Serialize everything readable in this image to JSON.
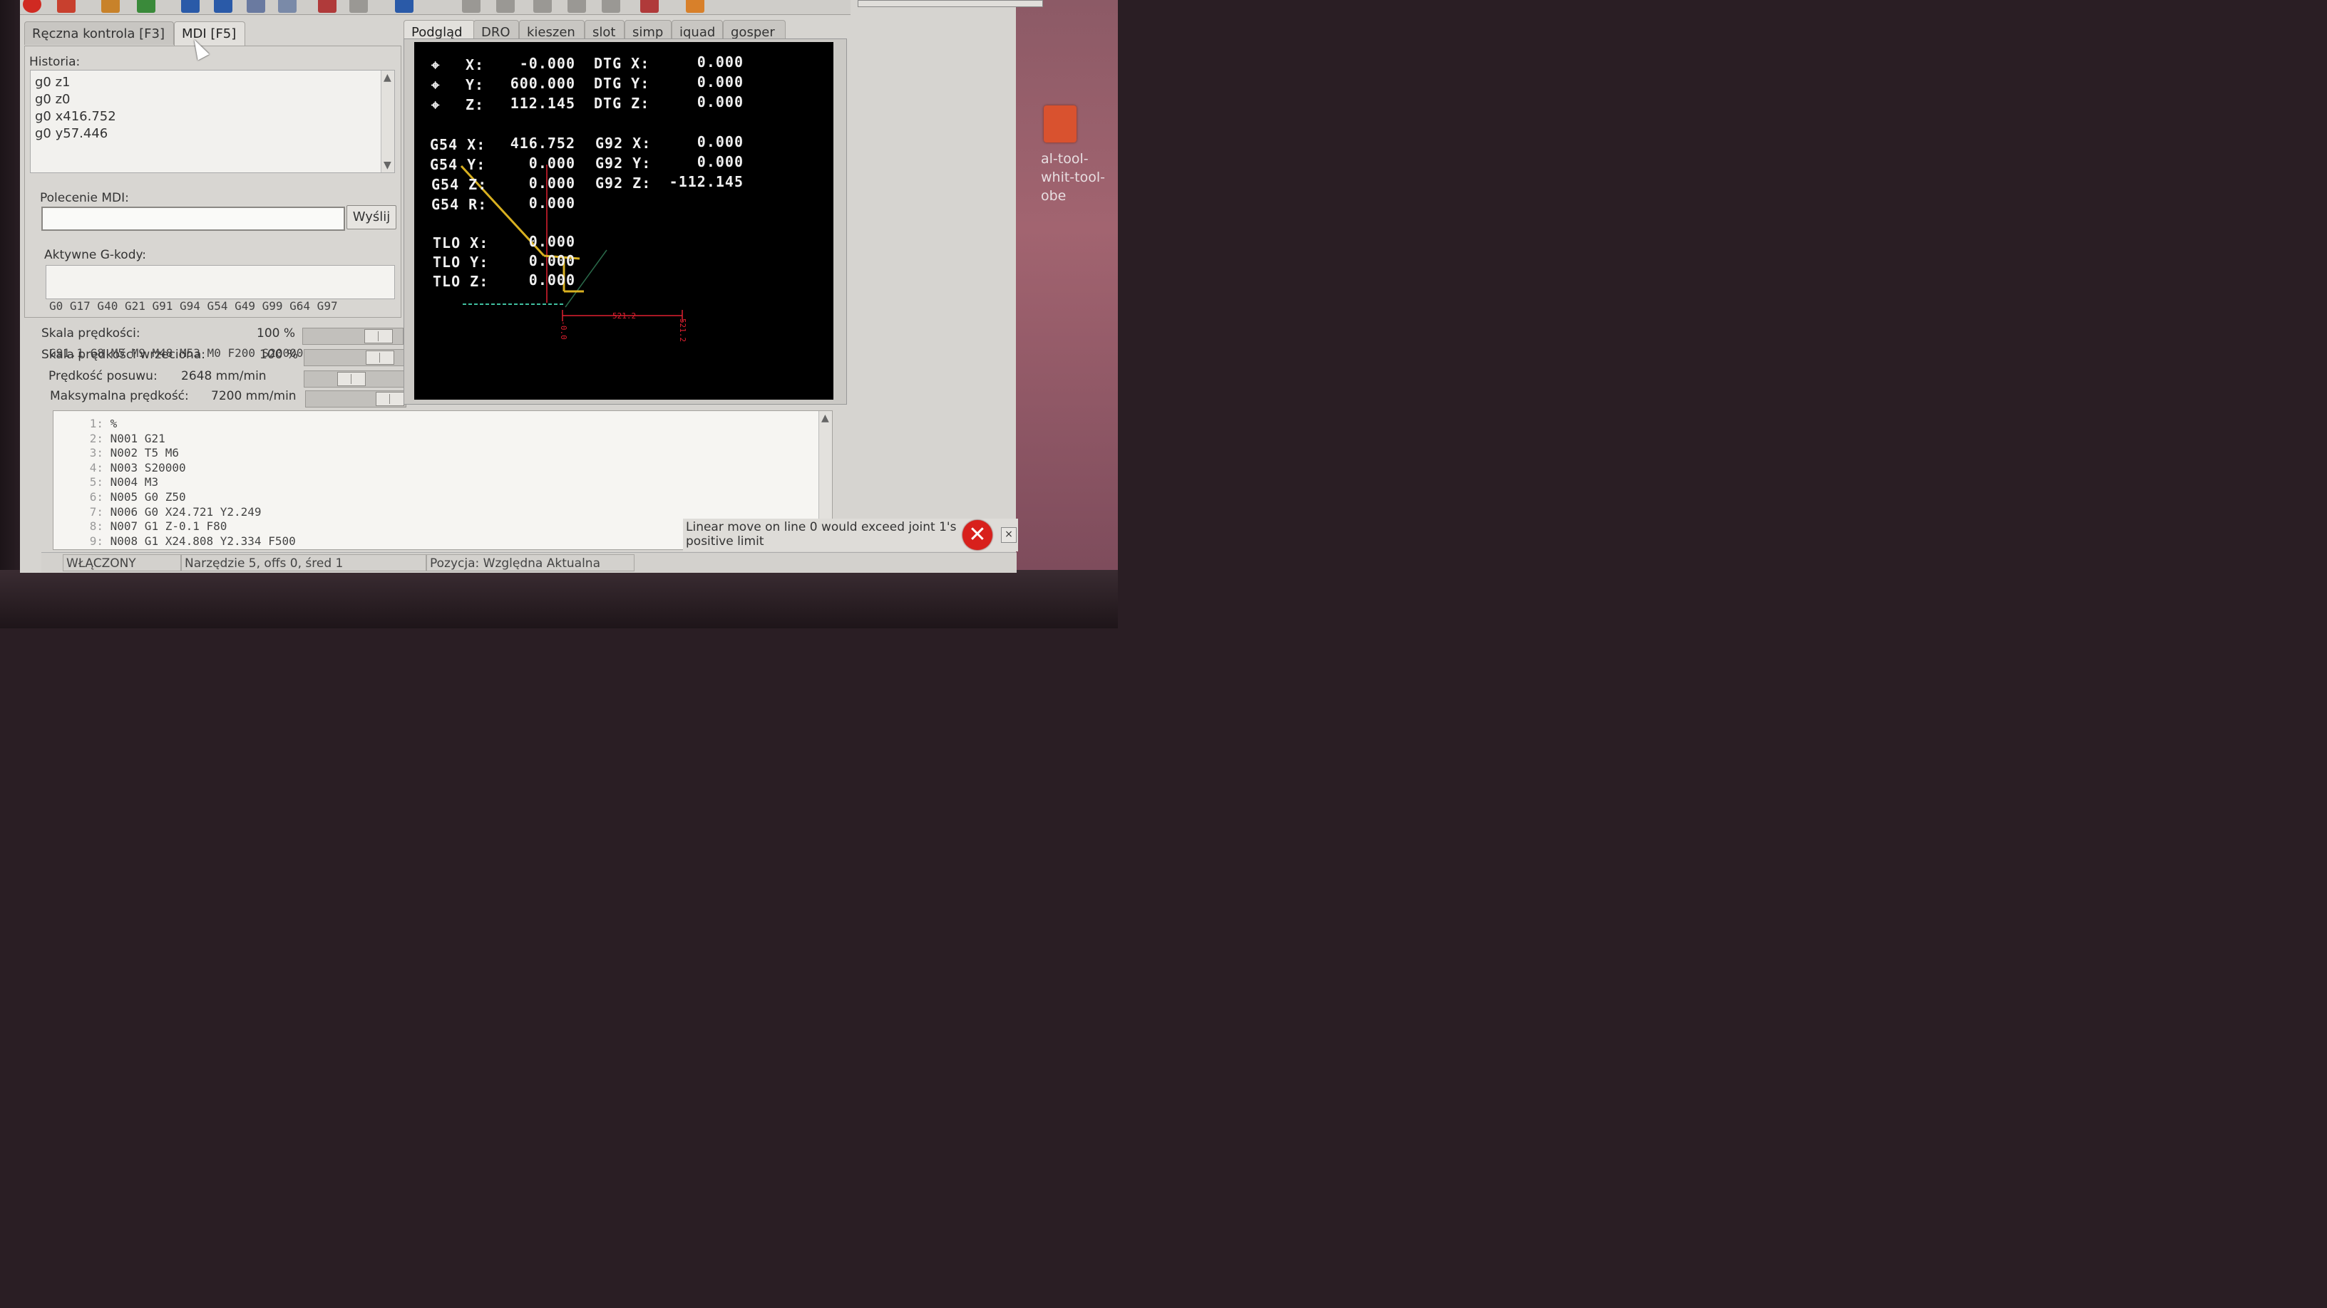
{
  "window": {
    "tabs_left": [
      {
        "label": "Ręczna kontrola [F3]",
        "active": false
      },
      {
        "label": "MDI [F5]",
        "active": true
      }
    ],
    "tabs_right": [
      {
        "label": "Podgląd",
        "active": true
      },
      {
        "label": "DRO",
        "active": false
      },
      {
        "label": "kieszen",
        "active": false
      },
      {
        "label": "slot",
        "active": false
      },
      {
        "label": "simp",
        "active": false
      },
      {
        "label": "iquad",
        "active": false
      },
      {
        "label": "gosper",
        "active": false
      }
    ]
  },
  "mdi": {
    "history_label": "Historia:",
    "history": [
      "g0 z1",
      "g0 z0",
      "g0 x416.752",
      "g0 y57.446"
    ],
    "command_label": "Polecenie MDI:",
    "command_value": "",
    "send_label": "Wyślij",
    "active_gcodes_label": "Aktywne G-kody:",
    "active_gcodes_line1": "G0 G17 G40 G21 G91 G94 G54 G49 G99 G64 G97",
    "active_gcodes_line2": "G91.1 G8 M5 M9 M48 M53 M0 F200 S20000"
  },
  "sliders": [
    {
      "name": "Skala prędkości:",
      "value": "100 %",
      "level": 1.0
    },
    {
      "name": "Skala prędkości wrzeciona:",
      "value": "100 %",
      "level": 1.0
    },
    {
      "name": "Prędkość posuwu:",
      "value": "2648 mm/min",
      "level": 0.37
    },
    {
      "name": "Maksymalna prędkość:",
      "value": "7200 mm/min",
      "level": 1.0
    }
  ],
  "dro": {
    "x_label": "X:",
    "x_value": "-0.000",
    "y_label": "Y:",
    "y_value": "600.000",
    "z_label": "Z:",
    "z_value": "112.145",
    "dtg_x_label": "DTG X:",
    "dtg_x": "0.000",
    "dtg_y_label": "DTG Y:",
    "dtg_y": "0.000",
    "dtg_z_label": "DTG Z:",
    "dtg_z": "0.000",
    "g54_x_label": "G54 X:",
    "g54_x": "416.752",
    "g54_y_label": "G54 Y:",
    "g54_y": "0.000",
    "g54_z_label": "G54 Z:",
    "g54_z": "0.000",
    "g54_r_label": "G54 R:",
    "g54_r": "0.000",
    "g92_x_label": "G92 X:",
    "g92_x": "0.000",
    "g92_y_label": "G92 Y:",
    "g92_y": "0.000",
    "g92_z_label": "G92 Z:",
    "g92_z": "-112.145",
    "tlo_x_label": "TLO X:",
    "tlo_x": "0.000",
    "tlo_y_label": "TLO Y:",
    "tlo_y": "0.000",
    "tlo_z_label": "TLO Z:",
    "tlo_z": "0.000",
    "dim_horizontal": "521.2",
    "dim_left": "-0.0",
    "dim_right": "521.2"
  },
  "program": [
    {
      "n": "1:",
      "code": "%"
    },
    {
      "n": "2:",
      "code": "N001 G21"
    },
    {
      "n": "3:",
      "code": "N002 T5 M6"
    },
    {
      "n": "4:",
      "code": "N003 S20000"
    },
    {
      "n": "5:",
      "code": "N004 M3"
    },
    {
      "n": "6:",
      "code": "N005 G0 Z50"
    },
    {
      "n": "7:",
      "code": "N006 G0 X24.721 Y2.249"
    },
    {
      "n": "8:",
      "code": "N007 G1 Z-0.1 F80"
    },
    {
      "n": "9:",
      "code": "N008 G1 X24.808 Y2.334 F500"
    }
  ],
  "status": {
    "state": "WŁĄCZONY",
    "tool": "Narzędzie 5, offs 0, śred 1",
    "position": "Pozycja: Względna Aktualna"
  },
  "notification": {
    "text": "Linear move on line 0 would exceed joint 1's positive limit",
    "icon": "error-icon",
    "close": "×"
  },
  "desktop": {
    "icon_label": "al-tool-\nwhit-tool-\nobe"
  },
  "colors": {
    "canvas_bg": "#000000",
    "dro_text": "#f0f0f0",
    "toolpath": "#d8b020",
    "dimension": "#e02030",
    "error_red": "#d8201c"
  }
}
